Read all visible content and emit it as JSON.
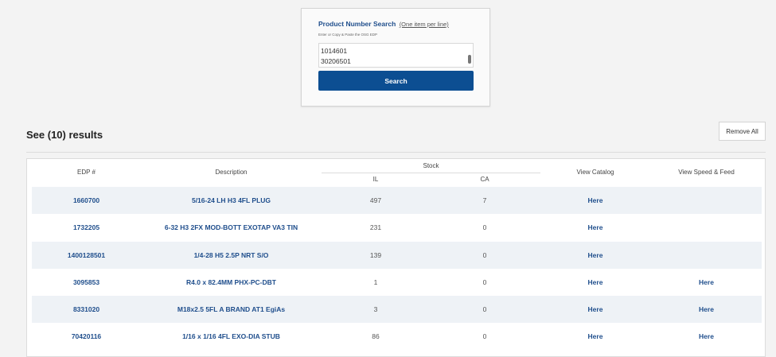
{
  "search": {
    "title": "Product Number Search",
    "title_hint": "(One item per line)",
    "instructions": "Enter or Copy & Paste the OSG EDP",
    "lines": [
      "1014601",
      "30206501"
    ],
    "button_label": "Search"
  },
  "results": {
    "heading": "See (10) results",
    "remove_all_label": "Remove All"
  },
  "table": {
    "headers": {
      "edp": "EDP #",
      "description": "Description",
      "stock": "Stock",
      "il": "IL",
      "ca": "CA",
      "view_catalog": "View Catalog",
      "view_speed_feed": "View Speed & Feed"
    },
    "rows": [
      {
        "edp": "1660700",
        "description": "5/16-24 LH H3 4FL PLUG",
        "il": "497",
        "ca": "7",
        "catalog": "Here",
        "speed_feed": ""
      },
      {
        "edp": "1732205",
        "description": "6-32 H3 2FX MOD-BOTT EXOTAP VA3 TIN",
        "il": "231",
        "ca": "0",
        "catalog": "Here",
        "speed_feed": ""
      },
      {
        "edp": "1400128501",
        "description": "1/4-28 H5 2.5P NRT S/O",
        "il": "139",
        "ca": "0",
        "catalog": "Here",
        "speed_feed": ""
      },
      {
        "edp": "3095853",
        "description": "R4.0 x 82.4MM PHX-PC-DBT",
        "il": "1",
        "ca": "0",
        "catalog": "Here",
        "speed_feed": "Here"
      },
      {
        "edp": "8331020",
        "description": "M18x2.5 5FL A BRAND AT1 EgiAs",
        "il": "3",
        "ca": "0",
        "catalog": "Here",
        "speed_feed": "Here"
      },
      {
        "edp": "70420116",
        "description": "1/16 x 1/16 4FL EXO-DIA STUB",
        "il": "86",
        "ca": "0",
        "catalog": "Here",
        "speed_feed": "Here"
      }
    ]
  }
}
